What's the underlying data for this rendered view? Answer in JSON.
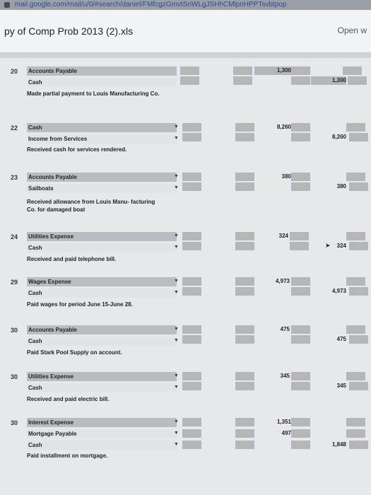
{
  "browser": {
    "url": "mail.google.com/mail/u/0/#search/daniel/FMfcgzGmvtSnWLgJSHhCMlpnHPPTsvbtpop"
  },
  "document": {
    "title": "py of Comp Prob 2013 (2).xls",
    "open_label": "Open w"
  },
  "entries": [
    {
      "date": "20",
      "accounts": [
        "Accounts Payable",
        "Cash"
      ],
      "memo": "Made partial payment to Louis Manufacturing Co.",
      "debit": "1,300",
      "credit": "1,300"
    },
    {
      "date": "22",
      "accounts": [
        "Cash",
        "Income from Services"
      ],
      "memo": "Received cash for services rendered.",
      "debit": "8,260",
      "credit": "8,260"
    },
    {
      "date": "23",
      "accounts": [
        "Accounts Payable",
        "Sailboats"
      ],
      "memo": "Received allowance from Louis Manu- facturing Co. for damaged boat",
      "debit": "380",
      "credit": "380"
    },
    {
      "date": "24",
      "accounts": [
        "Utilities Expense",
        "Cash"
      ],
      "memo": "Received and paid telephone bill.",
      "debit": "324",
      "credit": "324"
    },
    {
      "date": "29",
      "accounts": [
        "Wages Expense",
        "Cash"
      ],
      "memo": "Paid wages for period June 15-June 28.",
      "debit": "4,973",
      "credit": "4,973"
    },
    {
      "date": "30",
      "accounts": [
        "Accounts Payable",
        "Cash"
      ],
      "memo": "Paid Stark Pool Supply on account.",
      "debit": "475",
      "credit": "475"
    },
    {
      "date": "30",
      "accounts": [
        "Utilities Expense",
        "Cash"
      ],
      "memo": "Received and paid electric bill.",
      "debit": "345",
      "credit": "345"
    },
    {
      "date": "30",
      "accounts": [
        "Interest Expense",
        "Mortgage Payable",
        "Cash"
      ],
      "memo": "Paid installment on mortgage.",
      "debit": "1,351",
      "debit2": "497",
      "credit": "1,848"
    }
  ],
  "null_text": "null"
}
